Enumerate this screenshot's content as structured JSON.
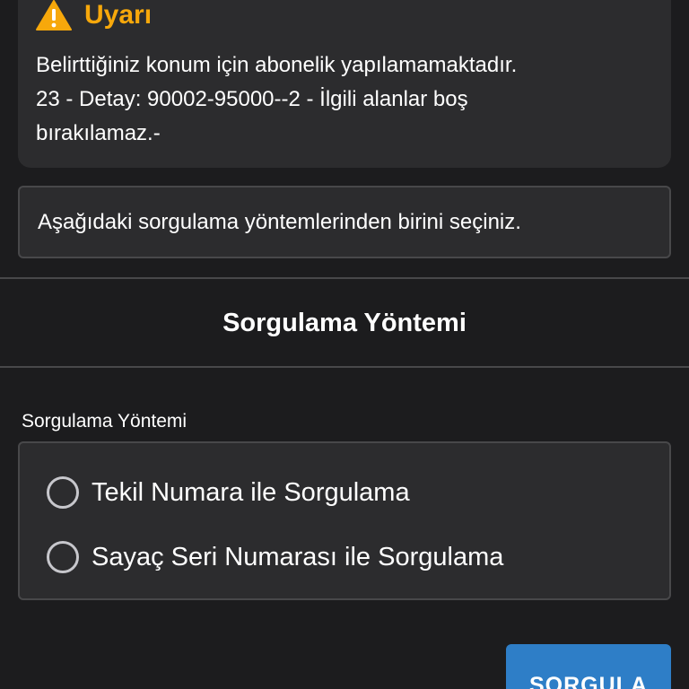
{
  "warning": {
    "icon": "warning-triangle-icon",
    "title": "Uyarı",
    "lines": [
      "Belirttiğiniz konum için abonelik yapılamamaktadır.",
      "23 - Detay: 90002-95000--2 - İlgili alanlar boş",
      "bırakılamaz.-"
    ],
    "accent_color": "#f7a80b"
  },
  "info": {
    "text": "Aşağıdaki sorgulama yöntemlerinden birini seçiniz."
  },
  "section": {
    "title": "Sorgulama Yöntemi"
  },
  "query_method": {
    "label": "Sorgulama Yöntemi",
    "options": [
      {
        "label": "Tekil Numara ile Sorgulama",
        "selected": false
      },
      {
        "label": "Sayaç Seri Numarası ile Sorgulama",
        "selected": false
      }
    ]
  },
  "submit": {
    "label": "SORGULA",
    "color": "#2e7ec7"
  }
}
